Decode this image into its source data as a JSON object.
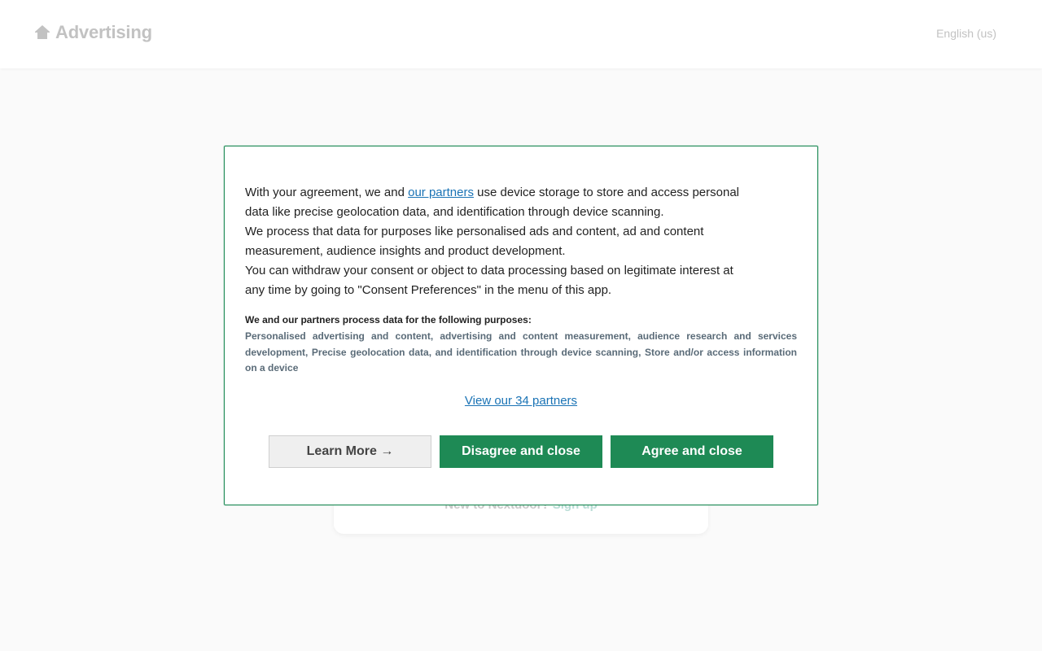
{
  "header": {
    "brand_label": "Advertising",
    "brand_icon": "house-icon",
    "language": "English (us)"
  },
  "background": {
    "signup_prompt": "New to Nextdoor?",
    "signup_link": "Sign up"
  },
  "consent": {
    "intro_prefix": "With your agreement, we and ",
    "partners_link": "our partners",
    "intro_suffix": " use device storage to store and access personal data like precise geolocation data, and identification through device scanning.",
    "processing": "We process that data for purposes like personalised ads and content, ad and content measurement, audience insights and product development.",
    "withdraw": "You can withdraw your consent or object to data processing based on legitimate interest at any time by going to \"Consent Preferences\" in the menu of this app.",
    "purposes_title": "We and our partners process data for the following purposes:",
    "purposes_list": "Personalised advertising and content, advertising and content measurement, audience research and services development, Precise geolocation data, and identification through device scanning, Store and/or access information on a device",
    "view_partners": "View our 34 partners",
    "buttons": {
      "learn_more": "Learn More →",
      "disagree": "Disagree and close",
      "agree": "Agree and close"
    }
  },
  "colors": {
    "accent": "#1e8a55",
    "link": "#1a73b5",
    "muted_text": "#5a6b78"
  }
}
